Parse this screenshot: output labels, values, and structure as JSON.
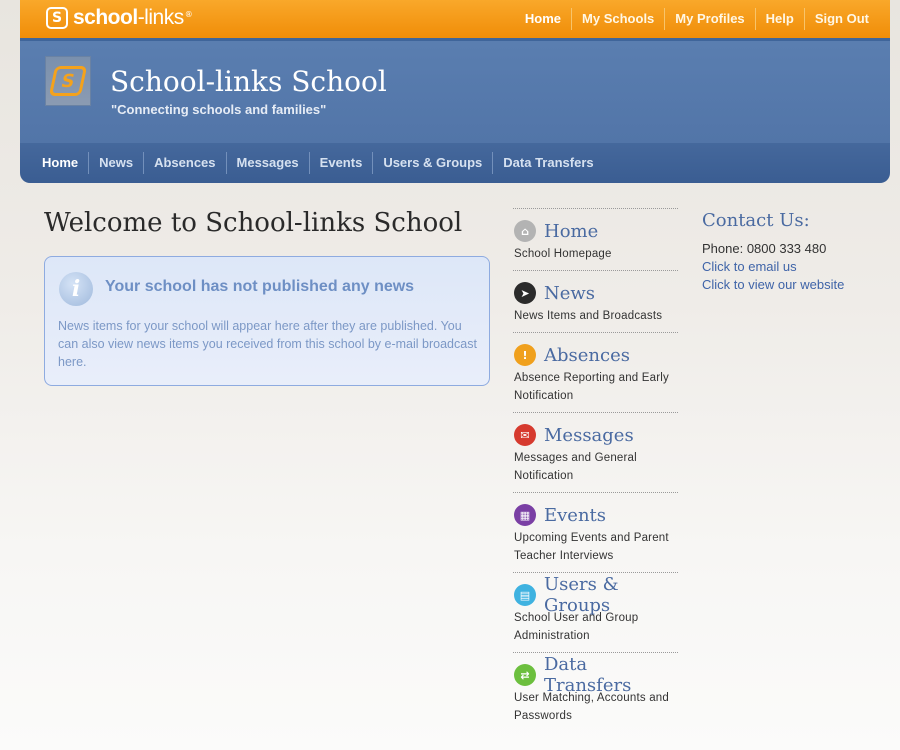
{
  "brand": {
    "logo_text": "school",
    "logo_text_thin": "-links",
    "logo_reg": "®"
  },
  "top_nav": {
    "home": "Home",
    "my_schools": "My Schools",
    "my_profiles": "My Profiles",
    "help": "Help",
    "sign_out": "Sign Out"
  },
  "header": {
    "title": "School-links School",
    "tagline": "\"Connecting schools and families\""
  },
  "main_nav": {
    "home": "Home",
    "news": "News",
    "absences": "Absences",
    "messages": "Messages",
    "events": "Events",
    "users_groups": "Users & Groups",
    "data_transfers": "Data Transfers"
  },
  "welcome": "Welcome to School-links School",
  "notice": {
    "title": "Your school has not published any news",
    "body": "News items for your school will appear here after they are published. You can also view news items you received from this school by e-mail broadcast here."
  },
  "side_menu": [
    {
      "label": "Home",
      "desc": "School Homepage",
      "icon": "home-icon",
      "color": "#b3b3b3"
    },
    {
      "label": "News",
      "desc": "News Items and Broadcasts",
      "icon": "news-icon",
      "color": "#2b2b2b"
    },
    {
      "label": "Absences",
      "desc": "Absence Reporting and Early Notification",
      "icon": "alert-icon",
      "color": "#f0a01c"
    },
    {
      "label": "Messages",
      "desc": "Messages and General Notification",
      "icon": "mail-icon",
      "color": "#d63a2e"
    },
    {
      "label": "Events",
      "desc": "Upcoming Events and Parent Teacher Interviews",
      "icon": "calendar-icon",
      "color": "#7a3fa4"
    },
    {
      "label": "Users & Groups",
      "desc": "School User and Group Administration",
      "icon": "users-icon",
      "color": "#3fb2e0"
    },
    {
      "label": "Data Transfers",
      "desc": "User Matching, Accounts and Passwords",
      "icon": "transfer-icon",
      "color": "#6cbf3e"
    }
  ],
  "contact": {
    "title": "Contact Us:",
    "phone": "Phone: 0800 333 480",
    "email_link": "Click to email us",
    "website_link": "Click to view our website"
  }
}
